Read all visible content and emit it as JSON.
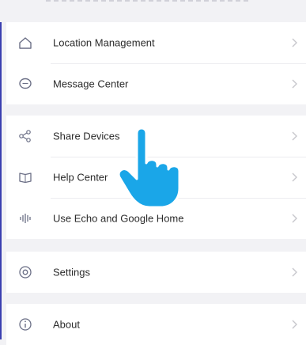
{
  "menu": {
    "group1": [
      {
        "label": "Location Management",
        "icon": "home-icon"
      },
      {
        "label": "Message Center",
        "icon": "chat-bubble-icon"
      }
    ],
    "group2": [
      {
        "label": "Share Devices",
        "icon": "share-icon"
      },
      {
        "label": "Help Center",
        "icon": "book-icon"
      },
      {
        "label": "Use Echo and Google Home",
        "icon": "voice-wave-icon"
      }
    ],
    "group3": [
      {
        "label": "Settings",
        "icon": "settings-icon"
      }
    ],
    "group4": [
      {
        "label": "About",
        "icon": "info-icon"
      }
    ]
  },
  "colors": {
    "icon": "#6b6f86",
    "chevron": "#c7c7cc",
    "pointer_hand": "#1aa6e8"
  }
}
